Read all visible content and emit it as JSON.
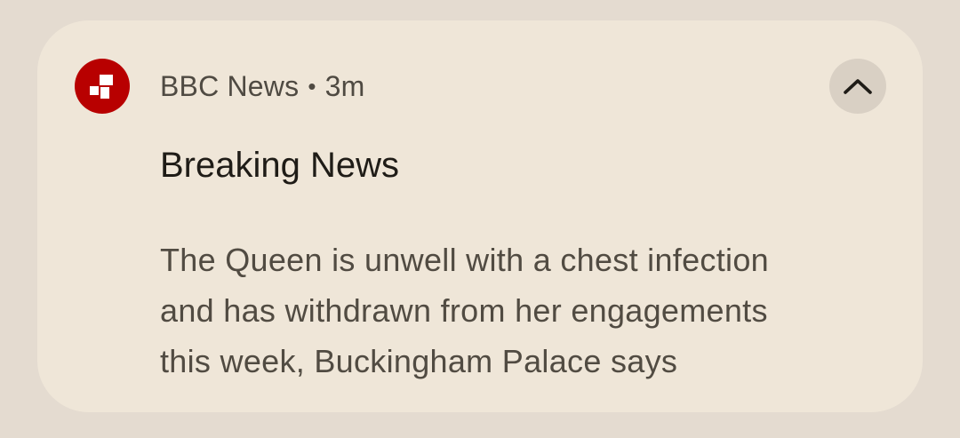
{
  "notification": {
    "app_name": "BBC News",
    "separator": "•",
    "time": "3m",
    "title": "Breaking News",
    "body_lines": [
      "The Queen is unwell with a chest infection",
      "and has withdrawn from her engagements",
      "this week, Buckingham Palace says"
    ],
    "icon": "bbc-news-icon",
    "collapse_icon": "chevron-up-icon"
  },
  "colors": {
    "background": "#e4dbd0",
    "card": "#efe6d8",
    "brand": "#b80000",
    "collapse_button": "#d9d0c4"
  }
}
